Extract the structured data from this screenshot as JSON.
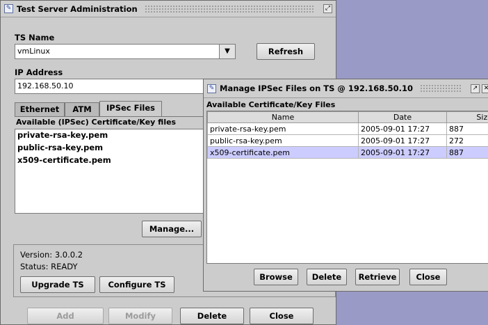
{
  "main_window": {
    "title": "Test Server Administration",
    "ts_name_label": "TS Name",
    "ts_name_value": "vmLinux",
    "refresh_label": "Refresh",
    "ip_label": "IP Address",
    "ip_value": "192.168.50.10",
    "tabs": [
      {
        "label": "Ethernet"
      },
      {
        "label": "ATM"
      },
      {
        "label": "IPSec Files"
      }
    ],
    "files_label": "Available (IPSec) Certificate/Key files",
    "files": [
      "private-rsa-key.pem",
      "public-rsa-key.pem",
      "x509-certificate.pem"
    ],
    "manage_label": "Manage...",
    "version_text": "Version: 3.0.0.2",
    "status_text": "Status:  READY",
    "upgrade_label": "Upgrade TS",
    "configure_label": "Configure TS",
    "add_label": "Add",
    "modify_label": "Modify",
    "delete_label": "Delete",
    "close_label": "Close"
  },
  "dialog": {
    "title": "Manage IPSec Files on TS @ 192.168.50.10",
    "section_label": "Available Certificate/Key Files",
    "columns": [
      "Name",
      "Date",
      "Size"
    ],
    "rows": [
      {
        "name": "private-rsa-key.pem",
        "date": "2005-09-01 17:27",
        "size": "887"
      },
      {
        "name": "public-rsa-key.pem",
        "date": "2005-09-01 17:27",
        "size": "272"
      },
      {
        "name": "x509-certificate.pem",
        "date": "2005-09-01 17:27",
        "size": "887"
      }
    ],
    "browse_label": "Browse",
    "delete_label": "Delete",
    "retrieve_label": "Retrieve",
    "close_label": "Close"
  }
}
